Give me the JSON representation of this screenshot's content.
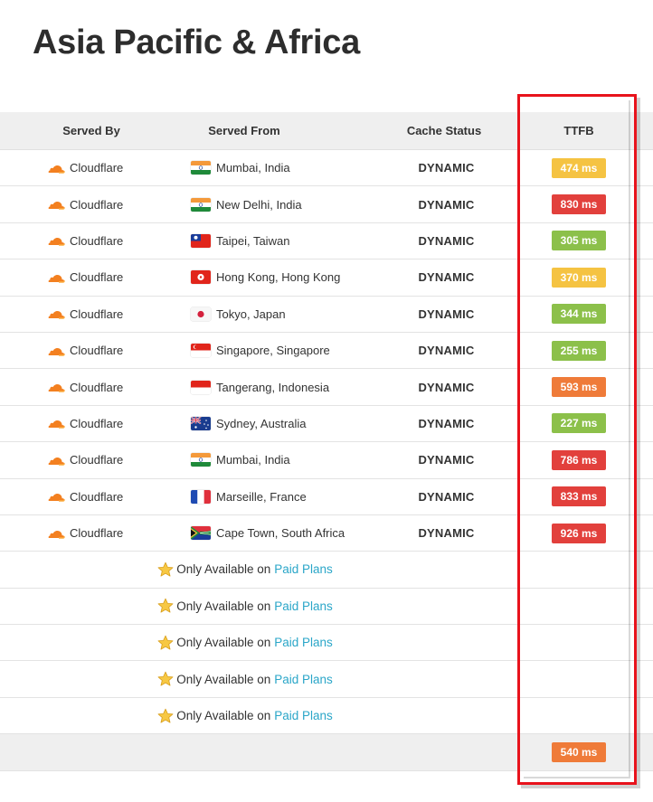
{
  "page": {
    "title": "Asia Pacific & Africa"
  },
  "table": {
    "headers": {
      "served_by": "Served By",
      "served_from": "Served From",
      "cache_status": "Cache Status",
      "ttfb": "TTFB"
    },
    "rows": [
      {
        "served_by": "Cloudflare",
        "location": "Mumbai, India",
        "flag": "india",
        "cache": "DYNAMIC",
        "ttfb": "474 ms",
        "ttfb_color": "#f5c342"
      },
      {
        "served_by": "Cloudflare",
        "location": "New Delhi, India",
        "flag": "india",
        "cache": "DYNAMIC",
        "ttfb": "830 ms",
        "ttfb_color": "#e2403c"
      },
      {
        "served_by": "Cloudflare",
        "location": "Taipei, Taiwan",
        "flag": "taiwan",
        "cache": "DYNAMIC",
        "ttfb": "305 ms",
        "ttfb_color": "#8cc04a"
      },
      {
        "served_by": "Cloudflare",
        "location": "Hong Kong, Hong Kong",
        "flag": "hong-kong",
        "cache": "DYNAMIC",
        "ttfb": "370 ms",
        "ttfb_color": "#f5c342"
      },
      {
        "served_by": "Cloudflare",
        "location": "Tokyo, Japan",
        "flag": "japan",
        "cache": "DYNAMIC",
        "ttfb": "344 ms",
        "ttfb_color": "#8cc04a"
      },
      {
        "served_by": "Cloudflare",
        "location": "Singapore, Singapore",
        "flag": "singapore",
        "cache": "DYNAMIC",
        "ttfb": "255 ms",
        "ttfb_color": "#8cc04a"
      },
      {
        "served_by": "Cloudflare",
        "location": "Tangerang, Indonesia",
        "flag": "indonesia",
        "cache": "DYNAMIC",
        "ttfb": "593 ms",
        "ttfb_color": "#ef7b39"
      },
      {
        "served_by": "Cloudflare",
        "location": "Sydney, Australia",
        "flag": "australia",
        "cache": "DYNAMIC",
        "ttfb": "227 ms",
        "ttfb_color": "#8cc04a"
      },
      {
        "served_by": "Cloudflare",
        "location": "Mumbai, India",
        "flag": "india",
        "cache": "DYNAMIC",
        "ttfb": "786 ms",
        "ttfb_color": "#e2403c"
      },
      {
        "served_by": "Cloudflare",
        "location": "Marseille, France",
        "flag": "france",
        "cache": "DYNAMIC",
        "ttfb": "833 ms",
        "ttfb_color": "#e2403c"
      },
      {
        "served_by": "Cloudflare",
        "location": "Cape Town, South Africa",
        "flag": "south-africa",
        "cache": "DYNAMIC",
        "ttfb": "926 ms",
        "ttfb_color": "#e2403c"
      }
    ],
    "paid_rows": [
      {
        "text": "Only Available on",
        "link": "Paid Plans"
      },
      {
        "text": "Only Available on",
        "link": "Paid Plans"
      },
      {
        "text": "Only Available on",
        "link": "Paid Plans"
      },
      {
        "text": "Only Available on",
        "link": "Paid Plans"
      },
      {
        "text": "Only Available on",
        "link": "Paid Plans"
      }
    ],
    "footer": {
      "average_ttfb": "540 ms",
      "average_color": "#ef7b39"
    }
  },
  "icons": {
    "provider_logo": "cloudflare-logo-icon",
    "paid_icon": "star-icon"
  },
  "colors": {
    "link": "#2aa6c8",
    "highlight_border": "#e8131c",
    "header_bg": "#efefef"
  }
}
